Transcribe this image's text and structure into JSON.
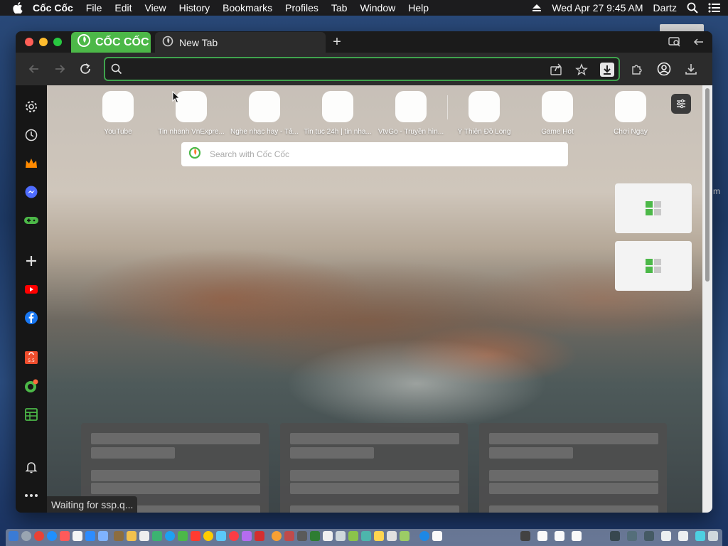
{
  "menubar": {
    "app_name": "Cốc Cốc",
    "items": [
      "File",
      "Edit",
      "View",
      "History",
      "Bookmarks",
      "Profiles",
      "Tab",
      "Window",
      "Help"
    ],
    "datetime": "Wed Apr 27  9:45 AM",
    "user": "Dartz"
  },
  "desktop": {
    "letter": "m"
  },
  "browser": {
    "brand_label": "CỐC CỐC",
    "tab_title": "New Tab",
    "omnibox_value": "",
    "omnibox_placeholder": "",
    "accent_color": "#4cb848"
  },
  "speed_dial": [
    {
      "label": "YouTube"
    },
    {
      "label": "Tin nhanh VnExpre..."
    },
    {
      "label": "Nghe nhạc hay - Tả..."
    },
    {
      "label": "Tin tuc 24h | tin nha..."
    },
    {
      "label": "VtvGo - Truyền hìn..."
    },
    {
      "label": "Ỷ Thiên Đồ Long"
    },
    {
      "label": "Game Hot"
    },
    {
      "label": "Chơi Ngay"
    }
  ],
  "newtab_search": {
    "placeholder": "Search with Cốc Cốc"
  },
  "status_text": "Waiting for ssp.q..."
}
